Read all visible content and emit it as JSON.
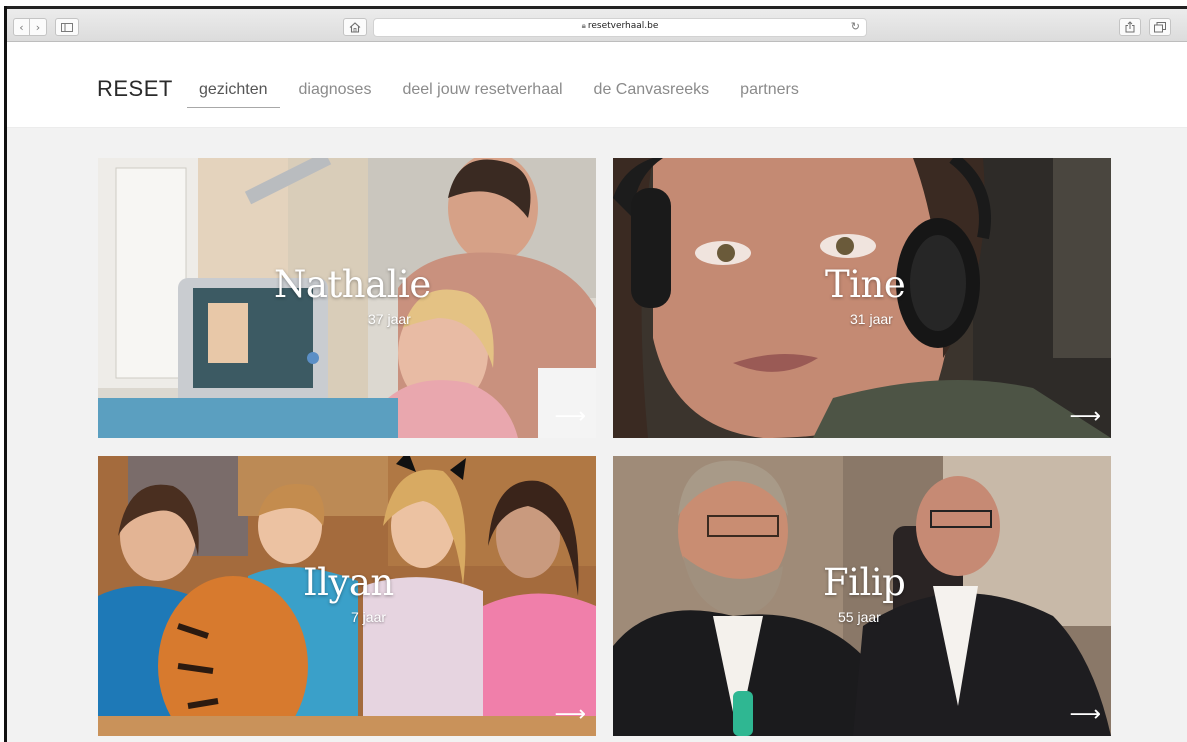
{
  "browser": {
    "url": "resetverhaal.be",
    "back_icon": "chevron-left-icon",
    "forward_icon": "chevron-right-icon",
    "sidebar_icon": "sidebar-icon",
    "home_icon": "home-icon",
    "lock_icon": "lock-icon",
    "reload_icon": "reload-icon",
    "share_icon": "share-icon",
    "tabs_icon": "tabs-icon"
  },
  "site": {
    "logo": "RESET",
    "nav": [
      {
        "label": "gezichten",
        "active": true
      },
      {
        "label": "diagnoses",
        "active": false
      },
      {
        "label": "deel jouw resetverhaal",
        "active": false
      },
      {
        "label": "de Canvasreeks",
        "active": false
      },
      {
        "label": "partners",
        "active": false
      }
    ]
  },
  "cards": [
    {
      "name": "Nathalie",
      "age": "37 jaar",
      "arrow": "⟶"
    },
    {
      "name": "Tine",
      "age": "31 jaar",
      "arrow": "⟶"
    },
    {
      "name": "Ilyan",
      "age": "7 jaar",
      "arrow": "⟶"
    },
    {
      "name": "Filip",
      "age": "55 jaar",
      "arrow": "⟶"
    }
  ]
}
